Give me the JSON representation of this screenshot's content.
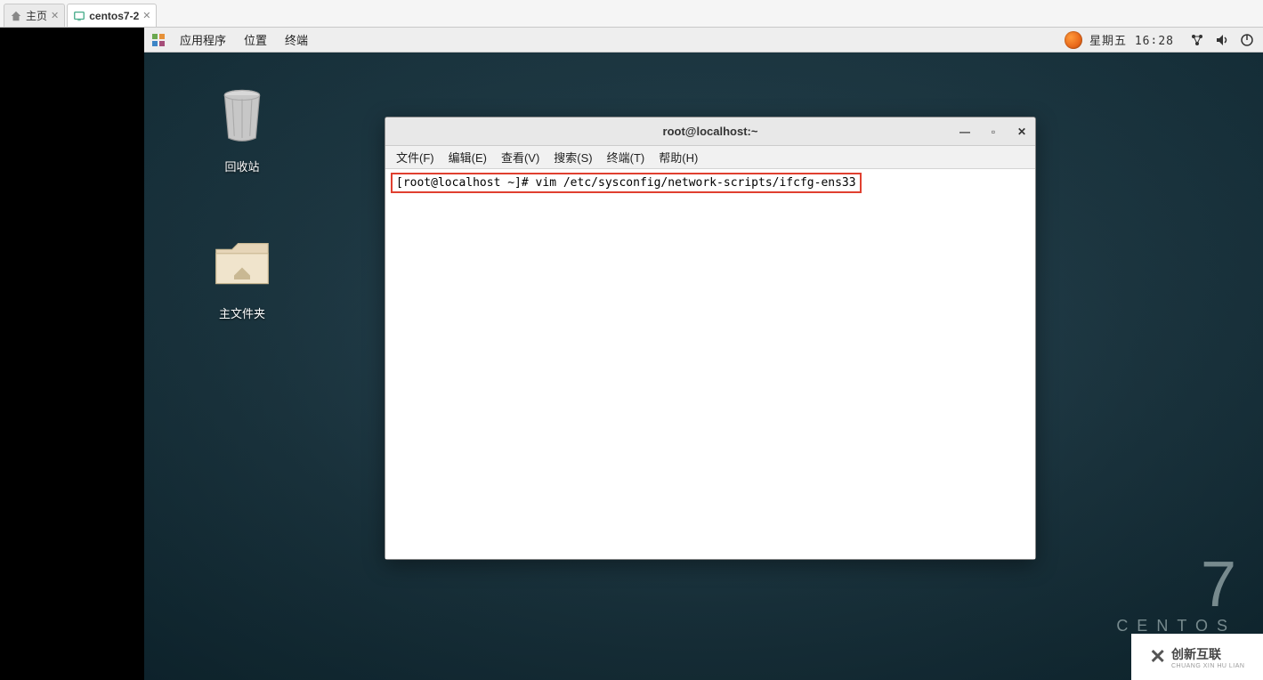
{
  "vmtabs": [
    {
      "label": "主页",
      "icon": "home"
    },
    {
      "label": "centos7-2",
      "icon": "vm"
    }
  ],
  "panel": {
    "menus": [
      "应用程序",
      "位置",
      "终端"
    ],
    "clock": "星期五 16∶28"
  },
  "desktop": {
    "trash": "回收站",
    "home": "主文件夹"
  },
  "watermark": {
    "num": "7",
    "name": "CENTOS"
  },
  "terminal": {
    "title": "root@localhost:~",
    "menus": [
      "文件(F)",
      "编辑(E)",
      "查看(V)",
      "搜索(S)",
      "终端(T)",
      "帮助(H)"
    ],
    "prompt": "[root@localhost ~]# ",
    "command": "vim /etc/sysconfig/network-scripts/ifcfg-ens33"
  },
  "logo": {
    "brand": "创新互联",
    "sub": "CHUANG XIN HU LIAN"
  }
}
